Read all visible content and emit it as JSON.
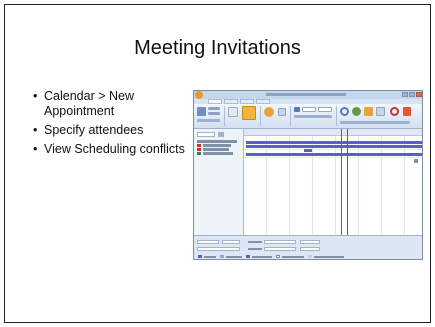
{
  "slide": {
    "title": "Meeting Invitations",
    "bullets": [
      "Calendar > New Appointment",
      "Specify attendees",
      "View Scheduling conflicts"
    ]
  },
  "screenshot": {
    "app": "Outlook scheduling assistant (thumbnail)",
    "colors": {
      "busy": "#5a5fc8",
      "meeting_start": "#2e8b3a",
      "meeting_end": "#c0392b",
      "office_button": "#e59b2e"
    }
  }
}
